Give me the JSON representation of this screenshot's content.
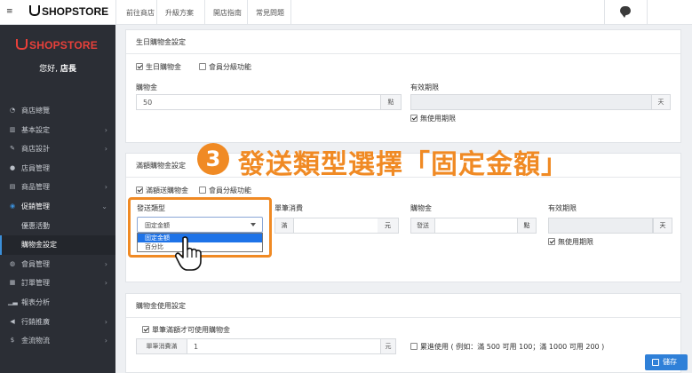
{
  "topbar": {
    "brand": "SHOPSTORE",
    "links": [
      "前往商店",
      "升級方案",
      "開店指南",
      "常見問題"
    ]
  },
  "sidebar": {
    "brand": "SHOPSTORE",
    "greeting": "您好, ",
    "user": "店長",
    "items": [
      {
        "label": "商店總覽",
        "icon": "dashboard-icon",
        "chevron": false
      },
      {
        "label": "基本設定",
        "icon": "bank-icon",
        "chevron": true
      },
      {
        "label": "商店設計",
        "icon": "magic-wand-icon",
        "chevron": true
      },
      {
        "label": "店員管理",
        "icon": "user-tie-icon",
        "chevron": false
      },
      {
        "label": "商品管理",
        "icon": "shop-icon",
        "chevron": true
      },
      {
        "label": "促銷管理",
        "icon": "promo-icon",
        "chevron": true
      }
    ],
    "sub_items": [
      "優惠活動",
      "購物金設定"
    ],
    "items_after": [
      {
        "label": "會員管理",
        "icon": "users-icon",
        "chevron": true
      },
      {
        "label": "訂單管理",
        "icon": "orders-icon",
        "chevron": true
      },
      {
        "label": "報表分析",
        "icon": "bar-chart-icon",
        "chevron": false
      },
      {
        "label": "行銷推廣",
        "icon": "megaphone-icon",
        "chevron": true
      },
      {
        "label": "金流物流",
        "icon": "dollar-icon",
        "chevron": true
      }
    ]
  },
  "birthday_panel": {
    "title": "生日購物金設定",
    "chk_birthday": "生日購物金",
    "chk_member_level": "會員分級功能",
    "amount_label": "購物金",
    "amount_value": "50",
    "amount_unit": "點",
    "validity_label": "有效期限",
    "validity_unit": "天",
    "no_limit": "無使用期限"
  },
  "spend_panel": {
    "title": "滿額購物金設定",
    "chk_spend": "滿額送購物金",
    "chk_member_level": "會員分級功能",
    "send_type_label": "發送類型",
    "send_type_value": "固定金額",
    "send_type_options": [
      "固定金額",
      "百分比"
    ],
    "min_spend_label": "單筆消費",
    "min_spend_prefix": "滿",
    "min_spend_unit": "元",
    "amount_label": "購物金",
    "amount_prefix": "發送",
    "amount_unit": "點",
    "validity_label": "有效期限",
    "validity_unit": "天",
    "no_limit": "無使用期限"
  },
  "usage_panel": {
    "title": "購物金使用設定",
    "chk_min_spend": "單筆滿額才可使用購物金",
    "min_spend_label": "單筆消費滿",
    "min_spend_value": "1",
    "min_spend_unit": "元",
    "chk_stack": "累進使用 ( 例如：滿 500 可用 100；滿 1000 可用 200 )"
  },
  "annotation": {
    "step": "3",
    "text": "發送類型選擇「固定金額」"
  },
  "save_label": "儲存",
  "colors": {
    "accent": "#f08a24",
    "primary": "#2f80d8",
    "brand_red": "#e8403a"
  }
}
